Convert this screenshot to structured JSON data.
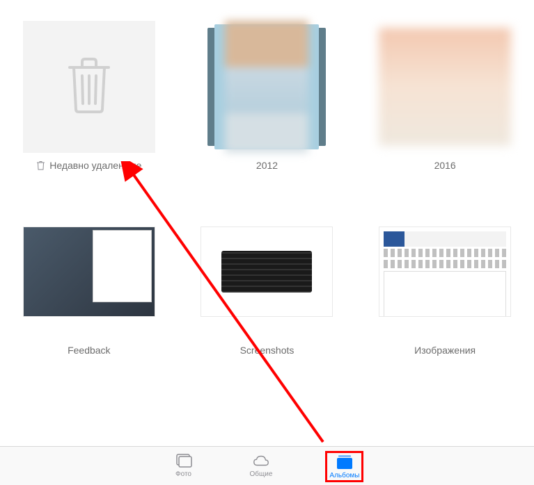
{
  "albums": [
    {
      "label": "Недавно удаленные",
      "type": "recently-deleted"
    },
    {
      "label": "2012",
      "type": "photo-stack"
    },
    {
      "label": "2016",
      "type": "photo"
    },
    {
      "label": "Feedback",
      "type": "screenshot"
    },
    {
      "label": "Screenshots",
      "type": "screenshot"
    },
    {
      "label": "Изображения",
      "type": "screenshot"
    }
  ],
  "tabs": {
    "photos": "Фото",
    "shared": "Общие",
    "albums": "Альбомы"
  },
  "colors": {
    "accent": "#007aff",
    "inactive": "#8e8e93",
    "annotation": "#ff0000"
  }
}
